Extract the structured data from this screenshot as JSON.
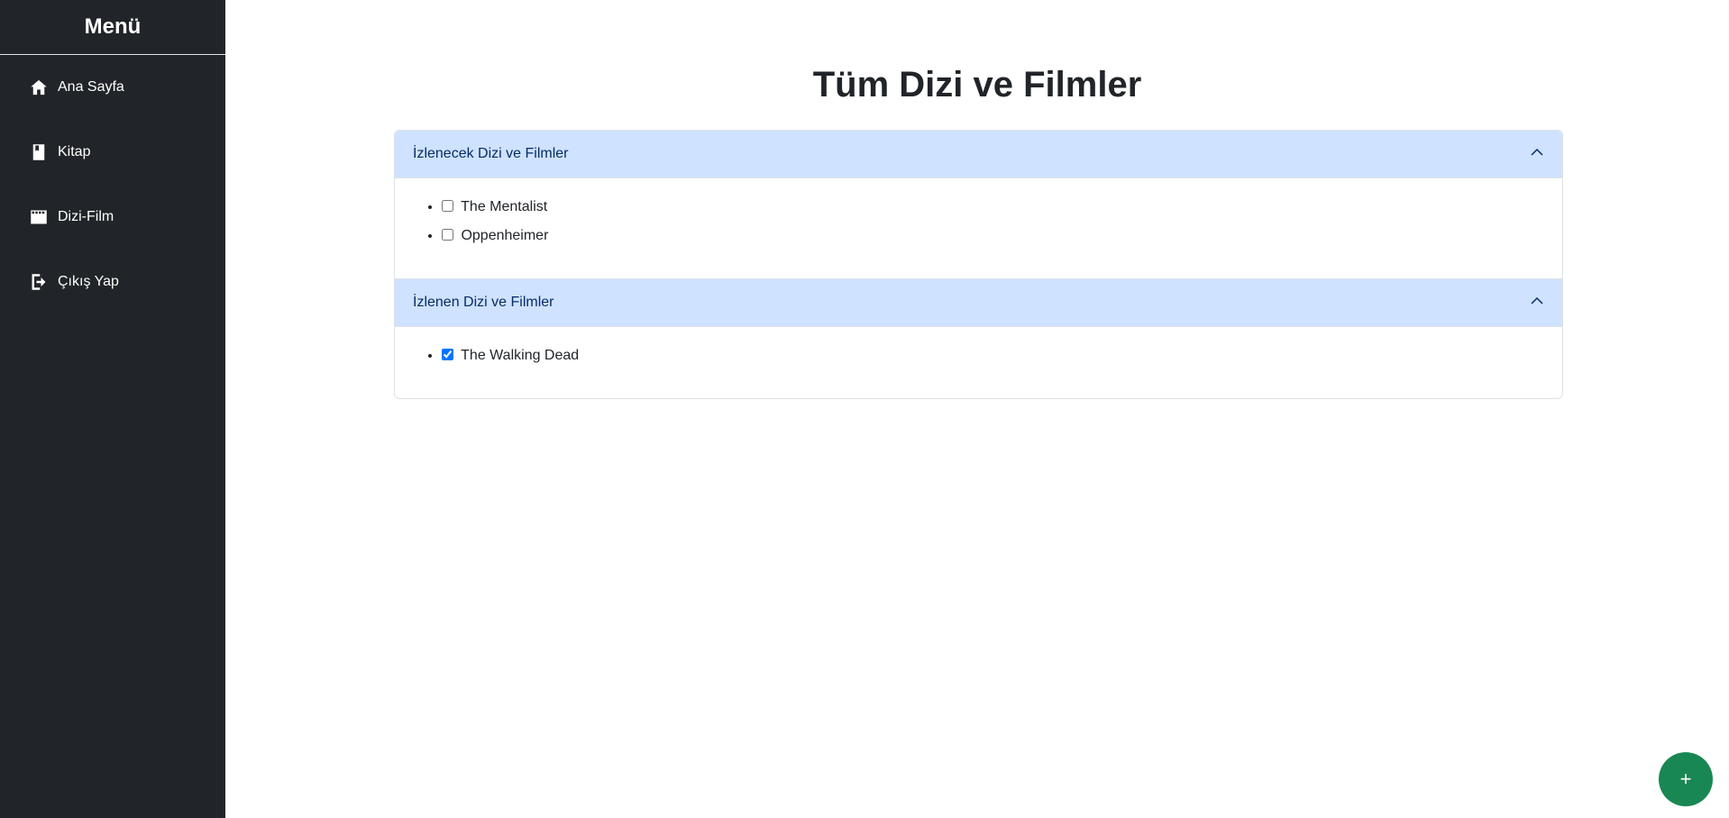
{
  "sidebar": {
    "title": "Menü",
    "items": [
      {
        "label": "Ana Sayfa",
        "icon": "house-icon"
      },
      {
        "label": "Kitap",
        "icon": "book-icon"
      },
      {
        "label": "Dizi-Film",
        "icon": "film-icon"
      },
      {
        "label": "Çıkış Yap",
        "icon": "logout-icon"
      }
    ]
  },
  "main": {
    "title": "Tüm Dizi ve Filmler",
    "sections": [
      {
        "header": "İzlenecek Dizi ve Filmler",
        "items": [
          {
            "label": "The Mentalist",
            "checked": false
          },
          {
            "label": "Oppenheimer",
            "checked": false
          }
        ]
      },
      {
        "header": "İzlenen Dizi ve Filmler",
        "items": [
          {
            "label": "The Walking Dead",
            "checked": true
          }
        ]
      }
    ]
  },
  "fab": {
    "label": "+"
  },
  "colors": {
    "sidebar_bg": "#212529",
    "accordion_header_bg": "#cfe2ff",
    "fab_bg": "#198754",
    "checkbox_accent": "#0d6efd"
  }
}
